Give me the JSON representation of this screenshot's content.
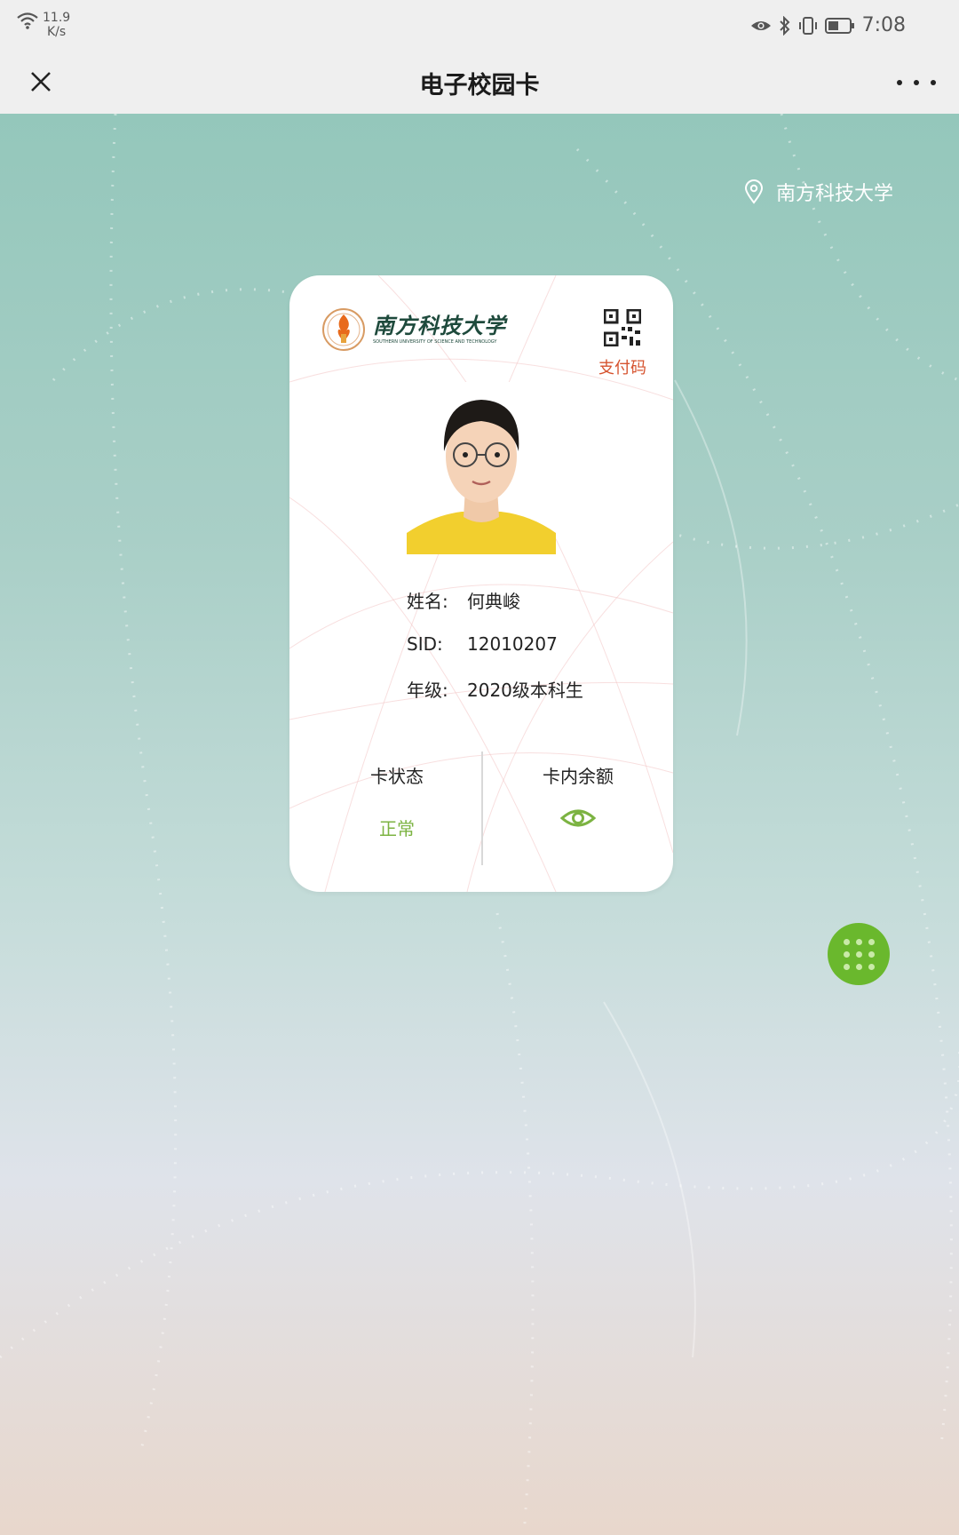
{
  "status_bar": {
    "net_speed_value": "11.9",
    "net_speed_unit": "K/s",
    "time": "7:08",
    "icons": [
      "wifi-icon",
      "eye-icon",
      "bluetooth-icon",
      "vibrate-icon",
      "battery-icon"
    ]
  },
  "title_bar": {
    "title": "电子校园卡",
    "close_icon": "close-icon",
    "more_icon": "more-icon"
  },
  "location": {
    "icon": "location-pin-icon",
    "label": "南方科技大学"
  },
  "card": {
    "university_name_cn": "南方科技大学",
    "university_name_en": "SOUTHERN UNIVERSITY OF SCIENCE AND TECHNOLOGY",
    "pay_code_label": "支付码",
    "fields": [
      {
        "label": "姓名:",
        "value": "何典峻"
      },
      {
        "label": "SID:",
        "value": "12010207"
      },
      {
        "label": "年级:",
        "value": "2020级本科生"
      }
    ],
    "status": {
      "title": "卡状态",
      "value": "正常"
    },
    "balance": {
      "title": "卡内余额",
      "icon": "eye-icon"
    }
  },
  "colors": {
    "accent_green": "#7cb342",
    "fab_green": "#6ab82d",
    "pay_red": "#d6532f",
    "bg_top": "#94c7bb"
  },
  "fab": {
    "icon": "grid-menu-icon"
  }
}
